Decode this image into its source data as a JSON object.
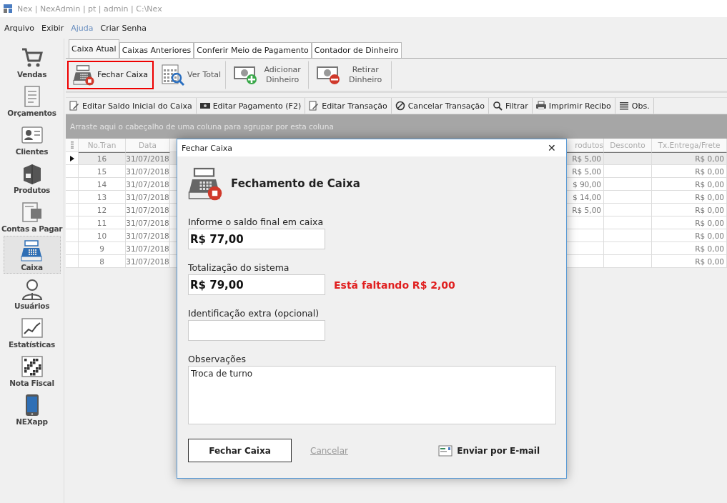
{
  "window": {
    "title": "Nex | NexAdmin | pt | admin | C:\\Nex"
  },
  "menu": [
    {
      "label": "Arquivo",
      "disabled": false
    },
    {
      "label": "Exibir",
      "disabled": false
    },
    {
      "label": "Ajuda",
      "disabled": true
    },
    {
      "label": "Criar Senha",
      "disabled": false
    }
  ],
  "sidebar": {
    "items": [
      {
        "label": "Vendas",
        "kind": "cart",
        "selected": false
      },
      {
        "label": "Orçamentos",
        "kind": "doc",
        "selected": false
      },
      {
        "label": "Clientes",
        "kind": "card",
        "selected": false
      },
      {
        "label": "Produtos",
        "kind": "box",
        "selected": false
      },
      {
        "label": "Contas a Pagar",
        "kind": "bill",
        "selected": false
      },
      {
        "label": "Caixa",
        "kind": "register",
        "selected": true
      },
      {
        "label": "Usuários",
        "kind": "user",
        "selected": false
      },
      {
        "label": "Estatísticas",
        "kind": "chart",
        "selected": false
      },
      {
        "label": "Nota Fiscal",
        "kind": "qr",
        "selected": false
      },
      {
        "label": "NEXapp",
        "kind": "phone",
        "selected": false
      }
    ]
  },
  "tabs": [
    {
      "label": "Caixa Atual",
      "selected": true
    },
    {
      "label": "Caixas Anteriores",
      "selected": false
    },
    {
      "label": "Conferir Meio de Pagamento",
      "selected": false
    },
    {
      "label": "Contador de Dinheiro",
      "selected": false
    }
  ],
  "toolbar": [
    {
      "label": "Fechar Caixa",
      "kind": "close",
      "selected": true
    },
    {
      "label": "Ver Total",
      "kind": "total",
      "selected": false
    },
    {
      "label": "Adicionar Dinheiro",
      "kind": "add",
      "selected": false
    },
    {
      "label": "Retirar Dinheiro",
      "kind": "remove",
      "selected": false
    }
  ],
  "actions": [
    {
      "label": "Editar Saldo Inicial do Caixa",
      "kind": "edit"
    },
    {
      "label": "Editar Pagamento (F2)",
      "kind": "money"
    },
    {
      "label": "Editar Transação",
      "kind": "edit"
    },
    {
      "label": "Cancelar Transação",
      "kind": "cancel"
    },
    {
      "label": "Filtrar",
      "kind": "search"
    },
    {
      "label": "Imprimir Recibo",
      "kind": "print"
    },
    {
      "label": "Obs.",
      "kind": "lines"
    }
  ],
  "group_hint": "Arraste aqui o cabeçalho de uma coluna para agrupar por esta coluna",
  "table": {
    "columns": [
      "No.Tran",
      "Data",
      "rodutos",
      "Desconto",
      "Tx.Entrega/Frete"
    ],
    "rows": [
      {
        "cells": [
          "16",
          "31/07/2018",
          "R$ 5,00",
          "",
          "R$ 0,00"
        ],
        "selected": true
      },
      {
        "cells": [
          "15",
          "31/07/2018",
          "R$ 5,00",
          "",
          "R$ 0,00"
        ],
        "selected": false
      },
      {
        "cells": [
          "14",
          "31/07/2018",
          "$ 90,00",
          "",
          "R$ 0,00"
        ],
        "selected": false
      },
      {
        "cells": [
          "13",
          "31/07/2018",
          "$ 14,00",
          "",
          "R$ 0,00"
        ],
        "selected": false
      },
      {
        "cells": [
          "12",
          "31/07/2018",
          "R$ 5,00",
          "",
          "R$ 0,00"
        ],
        "selected": false
      },
      {
        "cells": [
          "11",
          "31/07/2018",
          "",
          "",
          "R$ 0,00"
        ],
        "selected": false
      },
      {
        "cells": [
          "10",
          "31/07/2018",
          "",
          "",
          "R$ 0,00"
        ],
        "selected": false
      },
      {
        "cells": [
          "9",
          "31/07/2018",
          "",
          "",
          "R$ 0,00"
        ],
        "selected": false
      },
      {
        "cells": [
          "8",
          "31/07/2018",
          "",
          "",
          "R$ 0,00"
        ],
        "selected": false
      }
    ]
  },
  "dialog": {
    "title": "Fechar Caixa",
    "close": "✕",
    "heading": "Fechamento de Caixa",
    "fields": [
      {
        "label": "Informe o saldo final em caixa",
        "value": "R$ 77,00"
      },
      {
        "label": "Totalização do sistema",
        "value": "R$ 79,00",
        "warning": "Está faltando R$ 2,00"
      },
      {
        "label": "Identificação extra (opcional)"
      }
    ],
    "notes": {
      "label": "Observações",
      "value": "Troca de turno"
    },
    "buttons": [
      {
        "label": "Fechar Caixa",
        "kind": "primary"
      },
      {
        "label": "Cancelar",
        "kind": "link"
      },
      {
        "label": "Enviar por E-mail",
        "kind": "email"
      }
    ]
  }
}
